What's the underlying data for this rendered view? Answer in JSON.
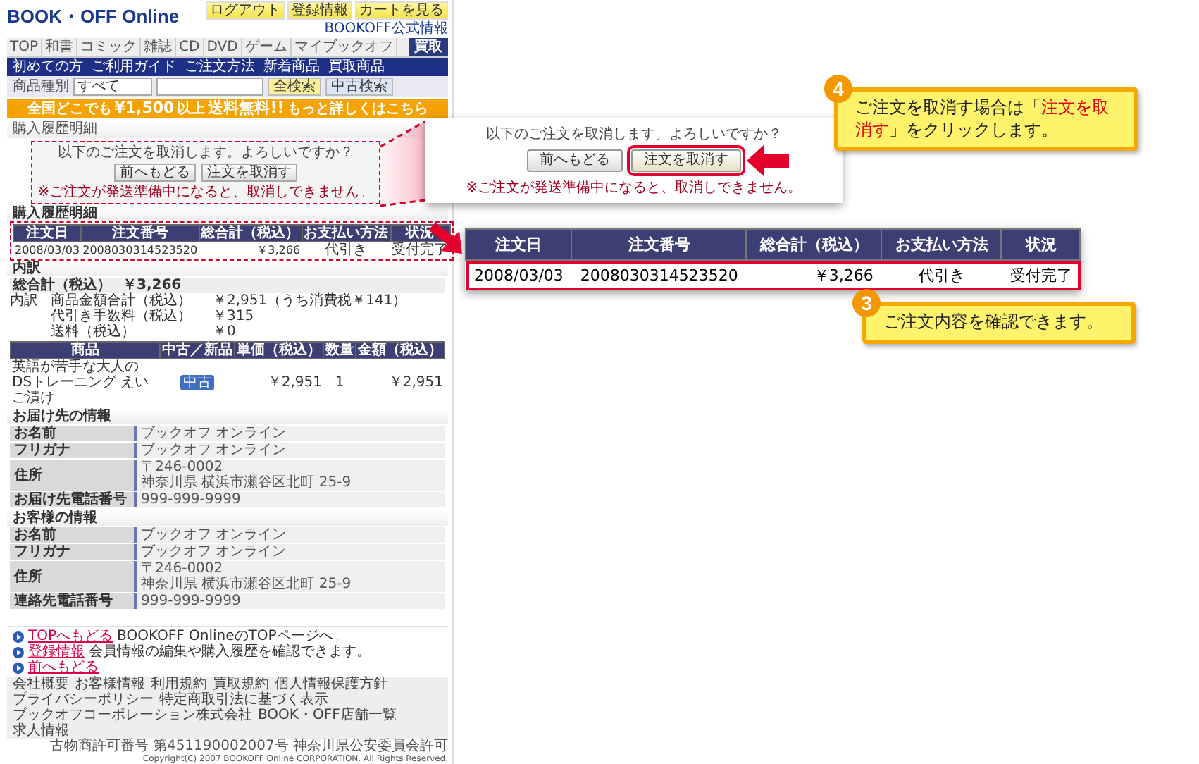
{
  "header": {
    "logo": "BOOK・OFF Online",
    "top_buttons": [
      "ログアウト",
      "登録情報",
      "カートを見る"
    ],
    "official_link": "BOOKOFF公式情報"
  },
  "nav": {
    "items": [
      "TOP",
      "和書",
      "コミック",
      "雑誌",
      "CD",
      "DVD",
      "ゲーム",
      "マイブックオフ"
    ],
    "buyback_button": "買取"
  },
  "subnav": [
    "初めての方",
    "ご利用ガイド",
    "ご注文方法",
    "新着商品",
    "買取商品"
  ],
  "search": {
    "label": "商品種別",
    "category": "すべて",
    "buttons": [
      "全検索",
      "中古検索"
    ]
  },
  "banner": {
    "lead": "全国どこでも",
    "amount": "¥1,500",
    "suffix": "以上",
    "highlight": "送料無料!!",
    "link": "もっと詳しくはこちら"
  },
  "page_title": "購入履歴明細",
  "confirm": {
    "question": "以下のご注文を取消します。よろしいですか？",
    "buttons": [
      "前へもどる",
      "注文を取消す"
    ],
    "note": "※ご注文が発送準備中になると、取消しできません。"
  },
  "order_section": {
    "title": "購入履歴明細",
    "columns": [
      "注文日",
      "注文番号",
      "総合計（税込）",
      "お支払い方法",
      "状況"
    ],
    "row": [
      "2008/03/03",
      "2008030314523520",
      "￥3,266",
      "代引き",
      "受付完了"
    ]
  },
  "breakdown": {
    "title": "内訳",
    "total_label": "総合計（税込）",
    "total": "￥3,266",
    "detail_label": "内訳",
    "items": [
      {
        "label": "商品金額合計（税込）",
        "value": "￥2,951（うち消費税￥141）"
      },
      {
        "label": "代引き手数料（税込）",
        "value": "￥315"
      },
      {
        "label": "送料（税込）",
        "value": "￥0"
      }
    ],
    "product_columns": [
      "商品",
      "中古／新品",
      "単価（税込）",
      "数量",
      "金額（税込）"
    ],
    "products": [
      {
        "name": "英語が苦手な大人のDSトレーニング えいご漬け",
        "condition": "中古",
        "price": "￥2,951",
        "quantity": "1",
        "amount": "￥2,951"
      }
    ]
  },
  "delivery": {
    "title": "お届け先の情報",
    "rows": [
      {
        "label": "お名前",
        "lines": [
          "ブックオフ オンライン"
        ]
      },
      {
        "label": "フリガナ",
        "lines": [
          "ブックオフ オンライン"
        ]
      },
      {
        "label": "住所",
        "lines": [
          "〒246-0002",
          "神奈川県 横浜市瀬谷区北町 25-9"
        ]
      },
      {
        "label": "お届け先電話番号",
        "lines": [
          "999-999-9999"
        ]
      }
    ]
  },
  "customer": {
    "title": "お客様の情報",
    "rows": [
      {
        "label": "お名前",
        "lines": [
          "ブックオフ オンライン"
        ]
      },
      {
        "label": "フリガナ",
        "lines": [
          "ブックオフ オンライン"
        ]
      },
      {
        "label": "住所",
        "lines": [
          "〒246-0002",
          "神奈川県 横浜市瀬谷区北町 25-9"
        ]
      },
      {
        "label": "連絡先電話番号",
        "lines": [
          "999-999-9999"
        ]
      }
    ]
  },
  "footer_links": [
    {
      "label": "TOPへもどる",
      "description": "BOOKOFF OnlineのTOPページへ。"
    },
    {
      "label": "登録情報",
      "description": "会員情報の編集や購入履歴を確認できます。"
    },
    {
      "label": "前へもどる"
    }
  ],
  "legal_links": [
    "会社概要",
    "お客様情報",
    "利用規約",
    "買取規約",
    "個人情報保護方針",
    "プライバシーポリシー",
    "特定商取引法に基づく表示",
    "ブックオフコーポレーション株式会社",
    "BOOK・OFF店舗一覧",
    "求人情報"
  ],
  "copyright": [
    "古物商許可番号 第451190002007号 神奈川県公安委員会許可",
    "Copyright(C) 2007 BOOKOFF Online CORPORATION. All Rights Reserved."
  ],
  "zoom_confirm": {
    "question": "以下のご注文を取消します。よろしいですか？",
    "buttons": [
      {
        "label": "前へもどる",
        "highlighted": false
      },
      {
        "label": "注文を取消す",
        "highlighted": true
      }
    ],
    "note": "※ご注文が発送準備中になると、取消しできません。"
  },
  "zoom_table": {
    "columns": [
      "注文日",
      "注文番号",
      "総合計（税込）",
      "お支払い方法",
      "状況"
    ],
    "row": [
      "2008/03/03",
      "2008030314523520",
      "￥3,266",
      "代引き",
      "受付完了"
    ]
  },
  "callouts": [
    {
      "number": "4",
      "parts": [
        {
          "text": "ご注文を取消す場合は「",
          "emphasis": false
        },
        {
          "text": "注文を取消す",
          "emphasis": true
        },
        {
          "text": "」をクリックします。",
          "emphasis": false
        }
      ]
    },
    {
      "number": "3",
      "parts": [
        {
          "text": "ご注文内容を確認できます。",
          "emphasis": false
        }
      ]
    }
  ]
}
